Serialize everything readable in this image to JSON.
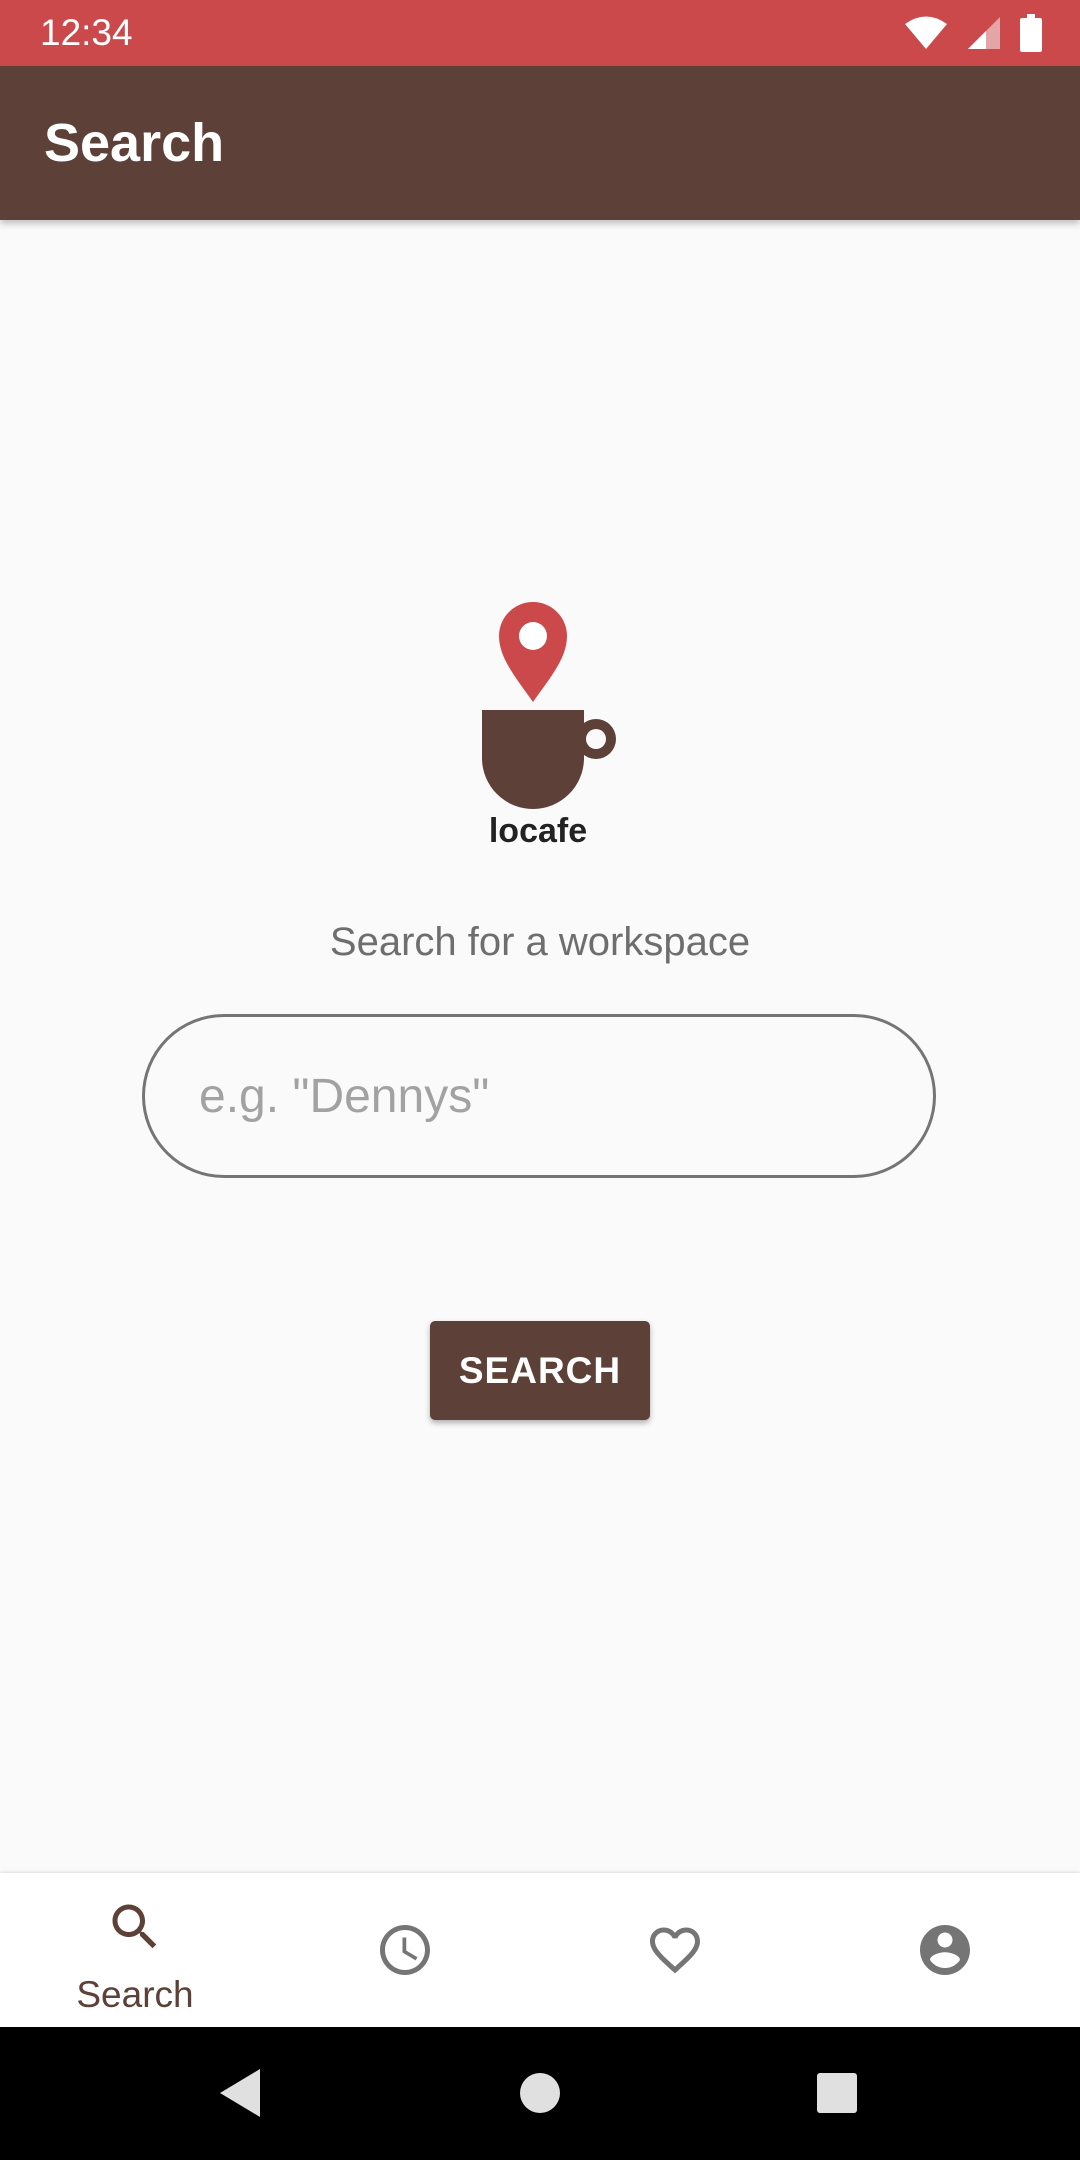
{
  "status_bar": {
    "time": "12:34",
    "icons": [
      "wifi-icon",
      "signal-icon",
      "battery-icon"
    ]
  },
  "app_bar": {
    "title": "Search"
  },
  "logo": {
    "brand_text": "locafe",
    "pin_color": "#CB494B",
    "cup_color": "#5D4037"
  },
  "search": {
    "prompt": "Search for a workspace",
    "placeholder": "e.g. \"Dennys\"",
    "value": "",
    "button_label": "SEARCH"
  },
  "bottom_nav": {
    "items": [
      {
        "icon": "search-icon",
        "label": "Search",
        "active": true
      },
      {
        "icon": "history-icon",
        "label": "",
        "active": false
      },
      {
        "icon": "heart-icon",
        "label": "",
        "active": false
      },
      {
        "icon": "account-icon",
        "label": "",
        "active": false
      }
    ]
  },
  "system_nav": {
    "buttons": [
      "back-icon",
      "home-icon",
      "recents-icon"
    ]
  },
  "colors": {
    "status_bar": "#CB494B",
    "primary": "#5D4037",
    "background": "#FAFAFA",
    "inactive_icon": "#757575"
  }
}
